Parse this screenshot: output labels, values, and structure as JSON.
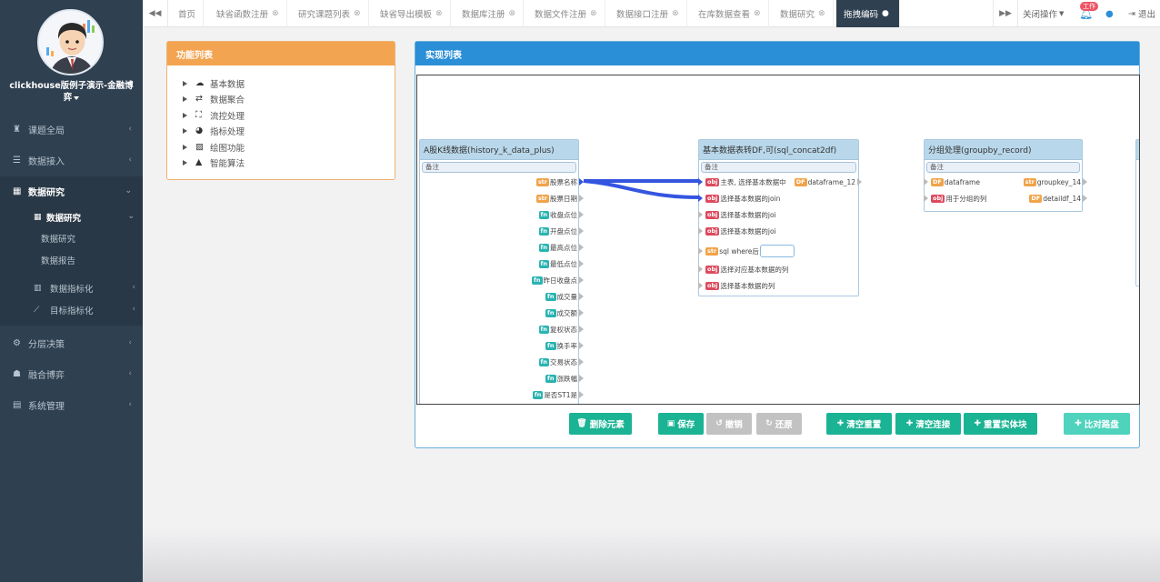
{
  "profile": {
    "name": "clickhouse版例子演示-金融博弈"
  },
  "sidebar": {
    "items": [
      {
        "label": "课题全局",
        "icon": "binoculars-icon"
      },
      {
        "label": "数据接入",
        "icon": "database-icon"
      },
      {
        "label": "数据研究",
        "icon": "table-icon"
      },
      {
        "label": "分层决策",
        "icon": "cogs-icon"
      },
      {
        "label": "融合博弈",
        "icon": "users-icon"
      },
      {
        "label": "系统管理",
        "icon": "grid-icon"
      }
    ],
    "sub": {
      "group_label": "数据研究",
      "links": [
        "数据研究",
        "数据报告"
      ],
      "nested": [
        "数据指标化",
        "目标指标化"
      ]
    }
  },
  "tabs": [
    {
      "label": "首页",
      "closable": false
    },
    {
      "label": "缺省函数注册",
      "closable": true
    },
    {
      "label": "研究课题列表",
      "closable": true
    },
    {
      "label": "缺省导出模板",
      "closable": true
    },
    {
      "label": "数据库注册",
      "closable": true
    },
    {
      "label": "数据文件注册",
      "closable": true
    },
    {
      "label": "数据接口注册",
      "closable": true
    },
    {
      "label": "在库数据查看",
      "closable": true
    },
    {
      "label": "数据研究",
      "closable": true
    },
    {
      "label": "拖拽编码",
      "closable": true,
      "active": true
    }
  ],
  "topbar": {
    "close_ops": "关闭操作",
    "notif_badge": "工作",
    "logout": "退出"
  },
  "function_panel": {
    "title": "功能列表",
    "items": [
      {
        "label": "基本数据",
        "icon": "cloud-icon"
      },
      {
        "label": "数据聚合",
        "icon": "exchange-icon"
      },
      {
        "label": "流控处理",
        "icon": "expand-icon"
      },
      {
        "label": "指标处理",
        "icon": "pie-chart-icon"
      },
      {
        "label": "绘图功能",
        "icon": "image-file-icon"
      },
      {
        "label": "智能算法",
        "icon": "graduation-cap-icon"
      }
    ]
  },
  "canvas_panel": {
    "title": "实现列表",
    "nodes": {
      "n1": {
        "title": "A股K线数据(history_k_data_plus)",
        "note": "备注",
        "outputs": [
          {
            "tag": "str",
            "label": "股票名称"
          },
          {
            "tag": "str",
            "label": "股票日期"
          },
          {
            "tag": "fn",
            "label": "收盘点位"
          },
          {
            "tag": "fn",
            "label": "开盘点位"
          },
          {
            "tag": "fn",
            "label": "最高点位"
          },
          {
            "tag": "fn",
            "label": "最低点位"
          },
          {
            "tag": "fn",
            "label": "昨日收盘点"
          },
          {
            "tag": "fn",
            "label": "成交量"
          },
          {
            "tag": "fn",
            "label": "成交额"
          },
          {
            "tag": "fn",
            "label": "复权状态"
          },
          {
            "tag": "fn",
            "label": "换手率"
          },
          {
            "tag": "fn",
            "label": "交易状态"
          },
          {
            "tag": "fn",
            "label": "涨跌幅"
          },
          {
            "tag": "fn",
            "label": "是否ST1是"
          }
        ]
      },
      "n2": {
        "title": "基本数据表转DF,可(sql_concat2df)",
        "note": "备注",
        "inputs": [
          {
            "tag": "obj",
            "label": "主表, 选择基本数据中"
          },
          {
            "tag": "obj",
            "label": "选择基本数据的join"
          },
          {
            "tag": "obj",
            "label": "选择基本数据的joi"
          },
          {
            "tag": "obj",
            "label": "选择基本数据的joi"
          },
          {
            "tag": "str",
            "label": "sql where后"
          },
          {
            "tag": "obj",
            "label": "选择对应基本数据的列"
          },
          {
            "tag": "obj",
            "label": "选择基本数据的列"
          }
        ],
        "output": {
          "tag": "DF",
          "label": "dataframe_12"
        }
      },
      "n3": {
        "title": "分组处理(groupby_record)",
        "note": "备注",
        "inputs": [
          {
            "tag": "DF",
            "label": "dataframe"
          },
          {
            "tag": "obj",
            "label": "用于分组的列"
          }
        ],
        "outputs": [
          {
            "tag": "str",
            "label": "groupkey_14"
          },
          {
            "tag": "DF",
            "label": "detaildf_14"
          }
        ]
      }
    },
    "buttons": [
      {
        "label": "删除元素",
        "icon": "trash-icon",
        "style": "green"
      },
      {
        "label": "保存",
        "icon": "save-icon",
        "style": "green"
      },
      {
        "label": "撤销",
        "icon": "undo-icon",
        "style": "gray"
      },
      {
        "label": "还原",
        "icon": "redo-icon",
        "style": "gray"
      },
      {
        "label": "清空重置",
        "icon": "plus-icon",
        "style": "green"
      },
      {
        "label": "清空连接",
        "icon": "plus-icon",
        "style": "green"
      },
      {
        "label": "重置实体块",
        "icon": "plus-icon",
        "style": "green"
      },
      {
        "label": "比对路盘",
        "icon": "plus-icon",
        "style": "lightgreen"
      }
    ]
  },
  "colors": {
    "sidebar_bg": "#2f4050",
    "accent_orange": "#f3a451",
    "accent_blue": "#2a8fd6",
    "btn_green": "#1ab394",
    "connector": "#3555e0"
  }
}
